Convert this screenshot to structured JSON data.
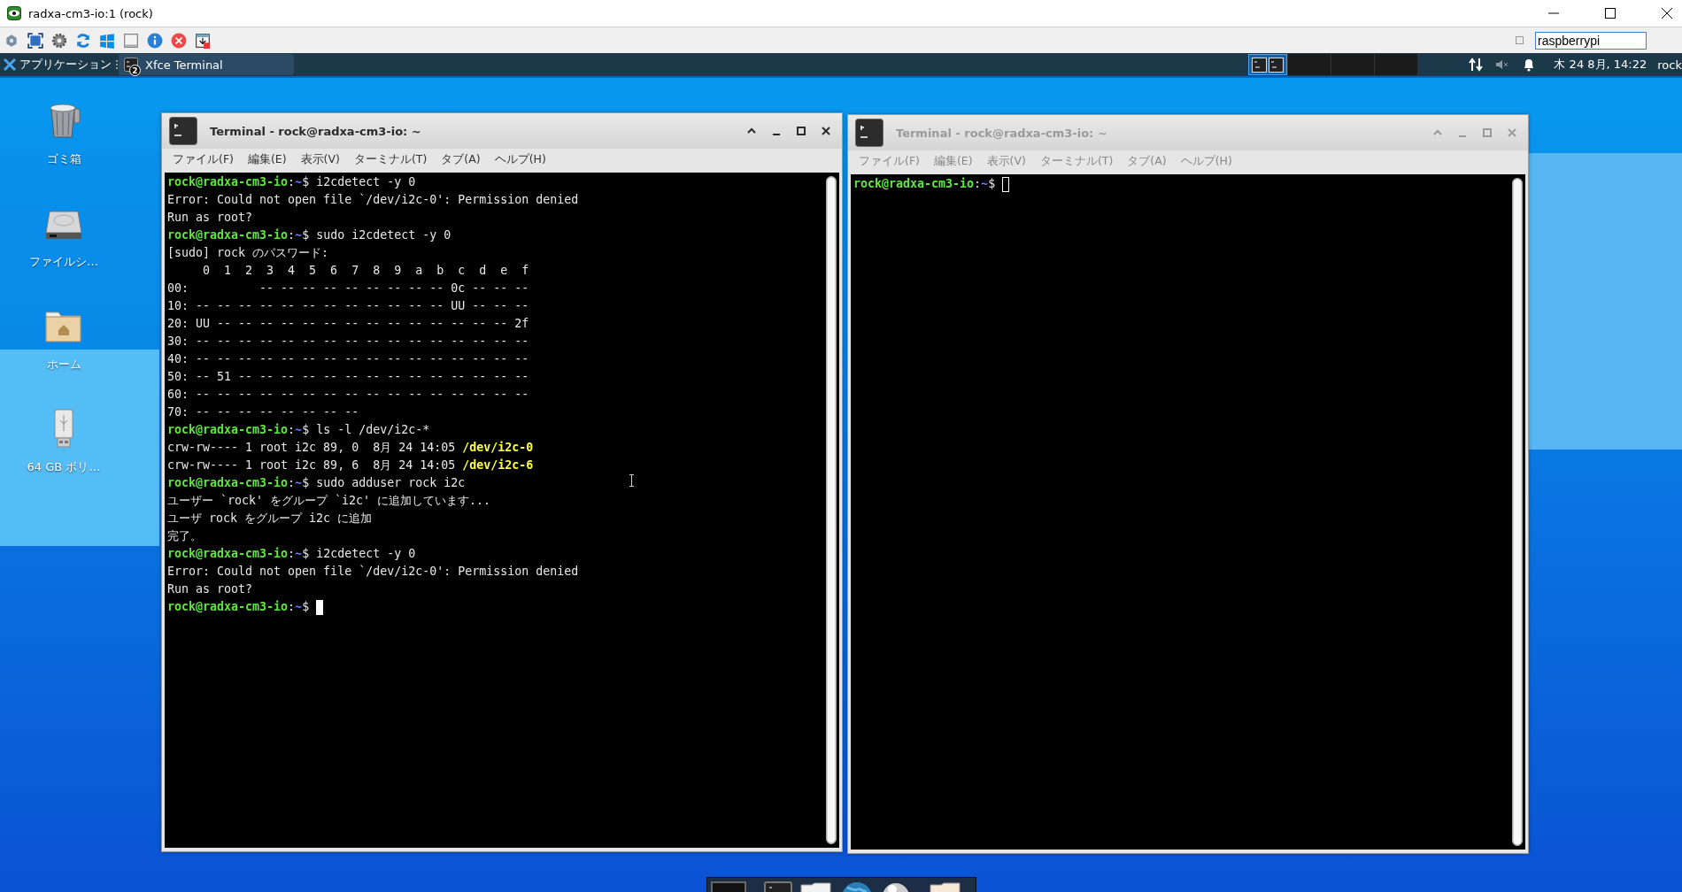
{
  "window": {
    "title": "radxa-cm3-io:1 (rock)"
  },
  "toolbar": {
    "host_field": {
      "value": "raspberrypi"
    }
  },
  "panel": {
    "app_menu": "アプリケーション",
    "tasks": [
      {
        "label": "Xfce Terminal",
        "badge": "2",
        "selected": true
      }
    ],
    "clock": "木 24 8月, 14:22",
    "user": "rock"
  },
  "desktop_icons": [
    {
      "label": "ゴミ箱",
      "kind": "trash"
    },
    {
      "label": "ファイルシ…",
      "kind": "drive"
    },
    {
      "label": "ホーム",
      "kind": "home"
    },
    {
      "label": "64 GB ボリ…",
      "kind": "usb"
    }
  ],
  "terminals": [
    {
      "title": "Terminal - rock@radxa-cm3-io: ~",
      "focused": true,
      "menu": [
        "ファイル(F)",
        "編集(E)",
        "表示(V)",
        "ターミナル(T)",
        "タブ(A)",
        "ヘルプ(H)"
      ],
      "lines": [
        [
          {
            "kind": "user",
            "text": "rock@radxa-cm3-io"
          },
          {
            "kind": "plain",
            "text": ":"
          },
          {
            "kind": "dir",
            "text": "~"
          },
          {
            "kind": "plain",
            "text": "$ i2cdetect -y 0"
          }
        ],
        [
          {
            "kind": "plain",
            "text": "Error: Could not open file `/dev/i2c-0': Permission denied"
          }
        ],
        [
          {
            "kind": "plain",
            "text": "Run as root?"
          }
        ],
        [
          {
            "kind": "user",
            "text": "rock@radxa-cm3-io"
          },
          {
            "kind": "plain",
            "text": ":"
          },
          {
            "kind": "dir",
            "text": "~"
          },
          {
            "kind": "plain",
            "text": "$ sudo i2cdetect -y 0"
          }
        ],
        [
          {
            "kind": "plain",
            "text": "[sudo] rock のパスワード:"
          }
        ],
        [
          {
            "kind": "plain",
            "text": "     0  1  2  3  4  5  6  7  8  9  a  b  c  d  e  f"
          }
        ],
        [
          {
            "kind": "plain",
            "text": "00:          -- -- -- -- -- -- -- -- -- 0c -- -- --"
          }
        ],
        [
          {
            "kind": "plain",
            "text": "10: -- -- -- -- -- -- -- -- -- -- -- -- UU -- -- --"
          }
        ],
        [
          {
            "kind": "plain",
            "text": "20: UU -- -- -- -- -- -- -- -- -- -- -- -- -- -- 2f"
          }
        ],
        [
          {
            "kind": "plain",
            "text": "30: -- -- -- -- -- -- -- -- -- -- -- -- -- -- -- --"
          }
        ],
        [
          {
            "kind": "plain",
            "text": "40: -- -- -- -- -- -- -- -- -- -- -- -- -- -- -- --"
          }
        ],
        [
          {
            "kind": "plain",
            "text": "50: -- 51 -- -- -- -- -- -- -- -- -- -- -- -- -- --"
          }
        ],
        [
          {
            "kind": "plain",
            "text": "60: -- -- -- -- -- -- -- -- -- -- -- -- -- -- -- --"
          }
        ],
        [
          {
            "kind": "plain",
            "text": "70: -- -- -- -- -- -- -- --"
          }
        ],
        [
          {
            "kind": "user",
            "text": "rock@radxa-cm3-io"
          },
          {
            "kind": "plain",
            "text": ":"
          },
          {
            "kind": "dir",
            "text": "~"
          },
          {
            "kind": "plain",
            "text": "$ ls -l /dev/i2c-*"
          }
        ],
        [
          {
            "kind": "plain",
            "text": "crw-rw---- 1 root i2c 89, 0  8月 24 14:05 "
          },
          {
            "kind": "path",
            "text": "/dev/i2c-0"
          }
        ],
        [
          {
            "kind": "plain",
            "text": "crw-rw---- 1 root i2c 89, 6  8月 24 14:05 "
          },
          {
            "kind": "path",
            "text": "/dev/i2c-6"
          }
        ],
        [
          {
            "kind": "user",
            "text": "rock@radxa-cm3-io"
          },
          {
            "kind": "plain",
            "text": ":"
          },
          {
            "kind": "dir",
            "text": "~"
          },
          {
            "kind": "plain",
            "text": "$ sudo adduser rock i2c"
          }
        ],
        [
          {
            "kind": "plain",
            "text": "ユーザー `rock' をグループ `i2c' に追加しています..."
          }
        ],
        [
          {
            "kind": "plain",
            "text": "ユーザ rock をグループ i2c に追加"
          }
        ],
        [
          {
            "kind": "plain",
            "text": "完了。"
          }
        ],
        [
          {
            "kind": "user",
            "text": "rock@radxa-cm3-io"
          },
          {
            "kind": "plain",
            "text": ":"
          },
          {
            "kind": "dir",
            "text": "~"
          },
          {
            "kind": "plain",
            "text": "$ i2cdetect -y 0"
          }
        ],
        [
          {
            "kind": "plain",
            "text": "Error: Could not open file `/dev/i2c-0': Permission denied"
          }
        ],
        [
          {
            "kind": "plain",
            "text": "Run as root?"
          }
        ],
        [
          {
            "kind": "user",
            "text": "rock@radxa-cm3-io"
          },
          {
            "kind": "plain",
            "text": ":"
          },
          {
            "kind": "dir",
            "text": "~"
          },
          {
            "kind": "plain",
            "text": "$ "
          },
          {
            "kind": "cursor"
          }
        ]
      ]
    },
    {
      "title": "Terminal - rock@radxa-cm3-io: ~",
      "focused": false,
      "menu": [
        "ファイル(F)",
        "編集(E)",
        "表示(V)",
        "ターミナル(T)",
        "タブ(A)",
        "ヘルプ(H)"
      ],
      "lines": [
        [
          {
            "kind": "user",
            "text": "rock@radxa-cm3-io"
          },
          {
            "kind": "plain",
            "text": ":"
          },
          {
            "kind": "dir",
            "text": "~"
          },
          {
            "kind": "plain",
            "text": "$ "
          },
          {
            "kind": "cursor"
          }
        ]
      ]
    }
  ]
}
